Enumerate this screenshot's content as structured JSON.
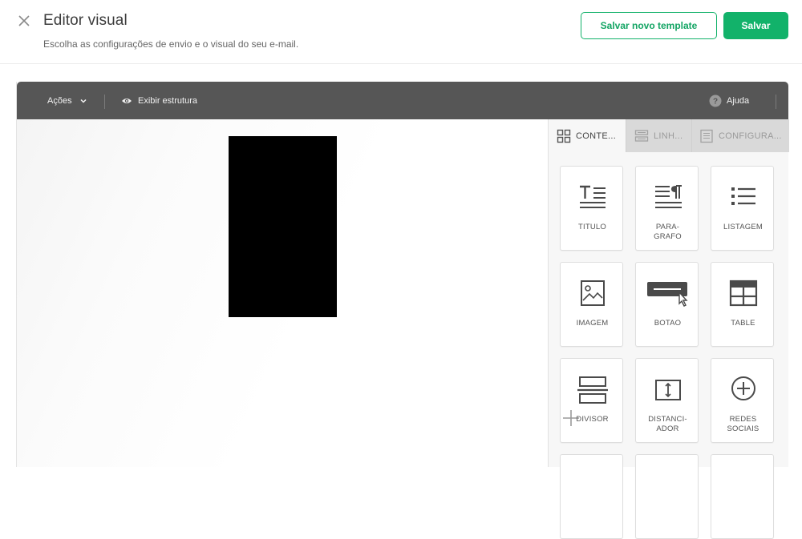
{
  "header": {
    "title": "Editor visual",
    "subtitle": "Escolha as configurações de envio e o visual do seu e-mail.",
    "save_template_label": "Salvar novo template",
    "save_label": "Salvar"
  },
  "toolbar": {
    "actions_label": "Ações",
    "show_structure_label": "Exibir estrutura",
    "help_label": "Ajuda"
  },
  "panel": {
    "tabs": [
      {
        "label": "CONTE...",
        "icon": "grid-icon",
        "active": true
      },
      {
        "label": "LINH...",
        "icon": "rows-icon",
        "active": false
      },
      {
        "label": "CONFIGURA...",
        "icon": "settings-page-icon",
        "active": false
      }
    ],
    "tiles": [
      {
        "label": "TITULO",
        "icon": "title-icon"
      },
      {
        "label": "PARA-\nGRAFO",
        "icon": "paragraph-icon"
      },
      {
        "label": "LISTAGEM",
        "icon": "list-icon"
      },
      {
        "label": "IMAGEM",
        "icon": "image-icon"
      },
      {
        "label": "BOTAO",
        "icon": "button-block-icon"
      },
      {
        "label": "TABLE",
        "icon": "table-icon"
      },
      {
        "label": "DIVISOR",
        "icon": "divider-icon"
      },
      {
        "label": "DISTANCI-\nADOR",
        "icon": "spacer-icon"
      },
      {
        "label": "REDES\nSOCIAIS",
        "icon": "social-icon"
      }
    ]
  },
  "colors": {
    "accent": "#12b26a",
    "toolbar": "#565656"
  }
}
